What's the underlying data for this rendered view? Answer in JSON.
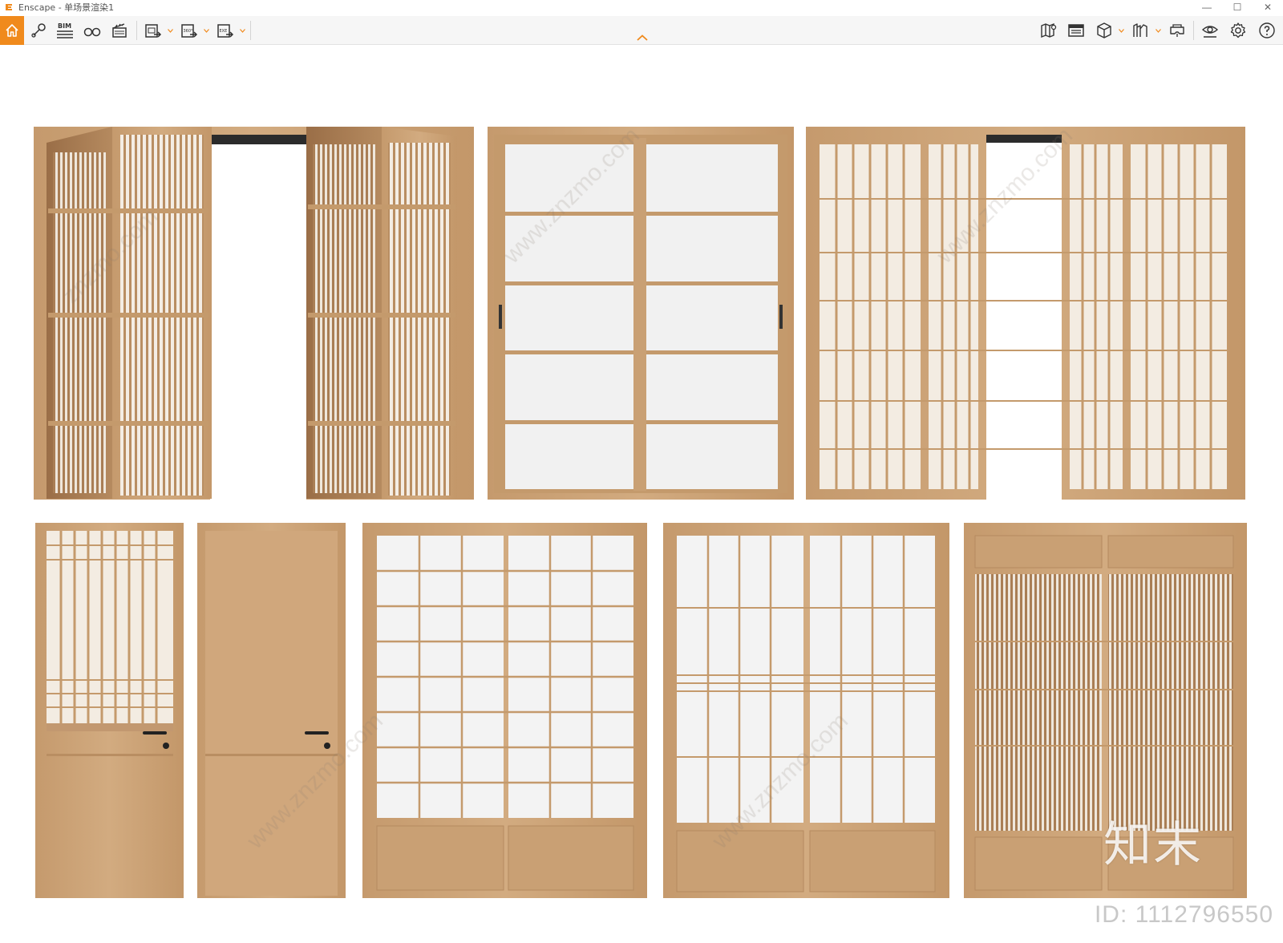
{
  "window": {
    "app_name": "Enscape",
    "separator": " - ",
    "document": "单场景渲染1",
    "minimize_glyph": "—",
    "maximize_glyph": "☐",
    "close_glyph": "✕"
  },
  "toolbar": {
    "bim_label": "BIM",
    "panorama_label": "360°",
    "exe_label": "EXE",
    "items_left": [
      "home-icon",
      "views-icon",
      "bim-icon",
      "binoculars-icon",
      "clapperboard-icon",
      "screenshot-export-icon",
      "panorama-export-icon",
      "exe-export-icon"
    ],
    "items_right": [
      "map-icon",
      "video-editor-icon",
      "cube-icon",
      "asset-library-icon",
      "vr-headset-icon",
      "visual-settings-icon",
      "settings-gear-icon",
      "help-icon"
    ],
    "accent_color": "#f08a1c"
  },
  "viewport": {
    "watermark_logo": "知末",
    "id_text": "ID: 1112796550"
  },
  "colors": {
    "wood": "#c89f73",
    "wood_dark": "#a57a51",
    "wood_light": "#dcbb95",
    "paper": "#efefef"
  }
}
